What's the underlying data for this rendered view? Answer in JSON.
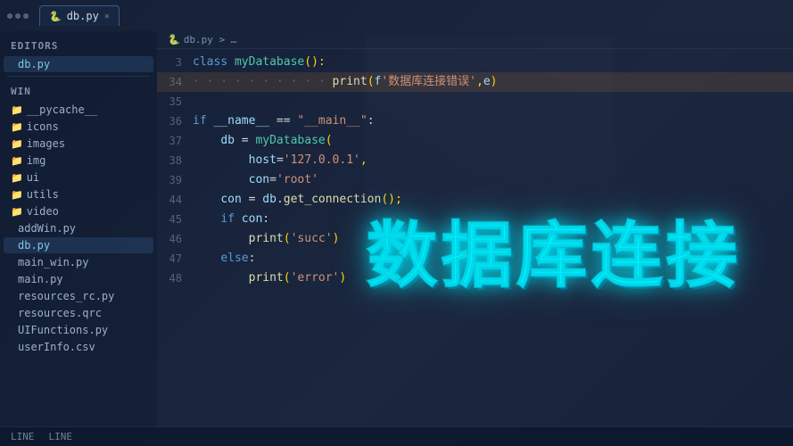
{
  "tab_bar": {
    "tab1": {
      "icon": "🐍",
      "label": "db.py",
      "close": "×",
      "active": true
    }
  },
  "sidebar": {
    "editors_section": "EDITORS",
    "editors_file": "db.py",
    "win_section": "WIN",
    "folders": [
      "__pycache__",
      "icons",
      "images",
      "img",
      "ui",
      "utils",
      "video"
    ],
    "files": [
      "addWin.py",
      "db.py",
      "main_win.py",
      "main.py",
      "resources_rc.py",
      "resources.qrc",
      "UIFunctions.py",
      "userInfo.csv"
    ]
  },
  "breadcrumb": {
    "path": "db.py > …"
  },
  "code_lines": [
    {
      "num": "3",
      "tokens": [
        {
          "type": "kw",
          "text": "class "
        },
        {
          "type": "cls",
          "text": "myDatabase"
        },
        {
          "type": "punc",
          "text": "():"
        }
      ],
      "highlighted": false
    },
    {
      "num": "34",
      "tokens": [
        {
          "type": "dots",
          "text": "· · · · · · · · · · "
        },
        {
          "type": "fn",
          "text": "print"
        },
        {
          "type": "punc",
          "text": "("
        },
        {
          "type": "builtin",
          "text": "f"
        },
        {
          "type": "str",
          "text": "'数据库连接错误'"
        },
        {
          "type": "punc",
          "text": ","
        },
        {
          "type": "builtin",
          "text": "e"
        },
        {
          "type": "punc",
          "text": ")"
        }
      ],
      "highlighted": true
    },
    {
      "num": "35",
      "tokens": [],
      "highlighted": false
    },
    {
      "num": "36",
      "tokens": [
        {
          "type": "kw",
          "text": "if "
        },
        {
          "type": "builtin",
          "text": "__name__"
        },
        {
          "type": "op",
          "text": " == "
        },
        {
          "type": "str",
          "text": "\"__main__\""
        },
        {
          "type": "op",
          "text": ":"
        }
      ],
      "highlighted": false
    },
    {
      "num": "37",
      "tokens": [
        {
          "type": "dots",
          "text": "    "
        },
        {
          "type": "builtin",
          "text": "db"
        },
        {
          "type": "op",
          "text": " = "
        },
        {
          "type": "cls",
          "text": "myDatabase"
        },
        {
          "type": "punc",
          "text": "("
        }
      ],
      "highlighted": false
    },
    {
      "num": "38",
      "tokens": [
        {
          "type": "dots",
          "text": "        "
        },
        {
          "type": "builtin",
          "text": "host"
        },
        {
          "type": "op",
          "text": "="
        },
        {
          "type": "str",
          "text": "'127.0.0.1'"
        },
        {
          "type": "punc",
          "text": ","
        }
      ],
      "highlighted": false
    },
    {
      "num": "39",
      "tokens": [
        {
          "type": "dots",
          "text": "        "
        },
        {
          "type": "builtin",
          "text": "con"
        },
        {
          "type": "op",
          "text": "="
        },
        {
          "type": "str",
          "text": "'root'"
        }
      ],
      "highlighted": false
    },
    {
      "num": "44",
      "tokens": [
        {
          "type": "dots",
          "text": "    "
        },
        {
          "type": "builtin",
          "text": "con"
        },
        {
          "type": "op",
          "text": " = "
        },
        {
          "type": "builtin",
          "text": "db"
        },
        {
          "type": "op",
          "text": "."
        },
        {
          "type": "fn",
          "text": "get_connection"
        },
        {
          "type": "punc",
          "text": "();"
        }
      ],
      "highlighted": false
    },
    {
      "num": "45",
      "tokens": [
        {
          "type": "dots",
          "text": "    "
        },
        {
          "type": "kw",
          "text": "if "
        },
        {
          "type": "builtin",
          "text": "con"
        },
        {
          "type": "op",
          "text": ":"
        }
      ],
      "highlighted": false
    },
    {
      "num": "46",
      "tokens": [
        {
          "type": "dots",
          "text": "        "
        },
        {
          "type": "fn",
          "text": "print"
        },
        {
          "type": "punc",
          "text": "("
        },
        {
          "type": "str",
          "text": "'succ'"
        },
        {
          "type": "punc",
          "text": ")"
        }
      ],
      "highlighted": false
    },
    {
      "num": "47",
      "tokens": [
        {
          "type": "dots",
          "text": "    "
        },
        {
          "type": "kw",
          "text": "else"
        },
        {
          "type": "op",
          "text": ":"
        }
      ],
      "highlighted": false
    },
    {
      "num": "48",
      "tokens": [
        {
          "type": "dots",
          "text": "        "
        },
        {
          "type": "fn",
          "text": "print"
        },
        {
          "type": "punc",
          "text": "("
        },
        {
          "type": "str",
          "text": "'error'"
        },
        {
          "type": "punc",
          "text": ")"
        }
      ],
      "highlighted": false
    }
  ],
  "big_title": "数据库连接",
  "status_bar": {
    "item1": "LINE",
    "item2": "LINE"
  }
}
